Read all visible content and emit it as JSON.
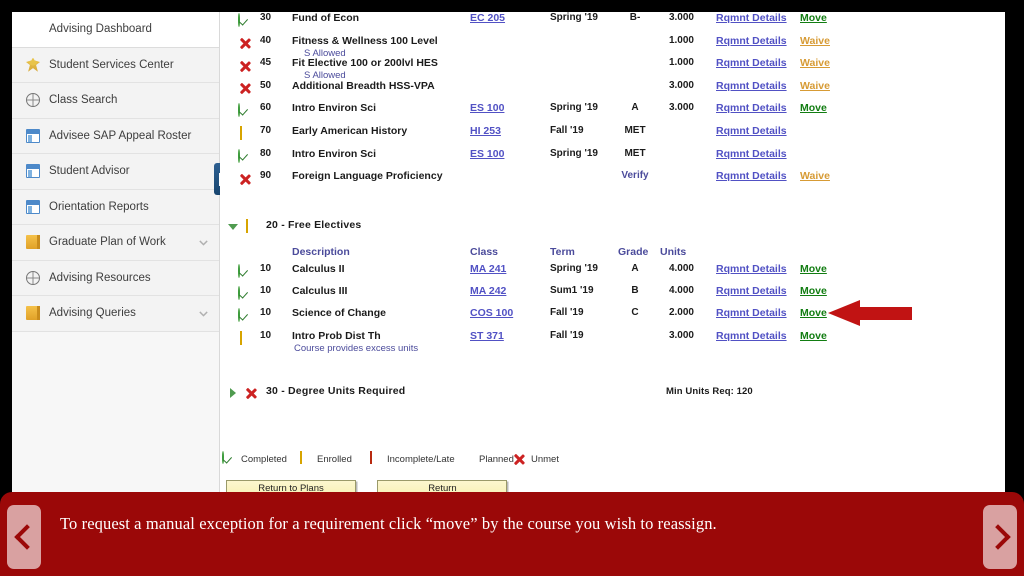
{
  "sidebar": {
    "items": [
      {
        "label": "Advising Dashboard",
        "icon": "none",
        "chevron": false
      },
      {
        "label": "Student Services Center",
        "icon": "person-star-icon",
        "chevron": false
      },
      {
        "label": "Class Search",
        "icon": "globe-icon",
        "chevron": false
      },
      {
        "label": "Advisee SAP Appeal Roster",
        "icon": "window-icon",
        "chevron": false
      },
      {
        "label": "Student Advisor",
        "icon": "window-icon",
        "chevron": false
      },
      {
        "label": "Orientation Reports",
        "icon": "window-icon",
        "chevron": false
      },
      {
        "label": "Graduate Plan of Work",
        "icon": "folder-icon",
        "chevron": true
      },
      {
        "label": "Advising Resources",
        "icon": "globe-icon",
        "chevron": false
      },
      {
        "label": "Advising Queries",
        "icon": "folder-icon",
        "chevron": true
      }
    ]
  },
  "main": {
    "top_rows": [
      {
        "status": "completed",
        "seq": "30",
        "desc": "Fund of Econ",
        "note": "",
        "class": "EC 205",
        "term": "Spring '19",
        "grade": "B-",
        "units": "3.000",
        "details": "Rqmnt Details",
        "action": "Move",
        "action_type": "move"
      },
      {
        "status": "unmet",
        "seq": "40",
        "desc": "Fitness & Wellness 100 Level",
        "note": "S Allowed",
        "class": "",
        "term": "",
        "grade": "",
        "units": "1.000",
        "details": "Rqmnt Details",
        "action": "Waive",
        "action_type": "waive"
      },
      {
        "status": "unmet",
        "seq": "45",
        "desc": "Fit Elective 100 or 200lvl HES",
        "note": "S Allowed",
        "class": "",
        "term": "",
        "grade": "",
        "units": "1.000",
        "details": "Rqmnt Details",
        "action": "Waive",
        "action_type": "waive"
      },
      {
        "status": "unmet",
        "seq": "50",
        "desc": "Additional Breadth HSS-VPA",
        "note": "",
        "class": "",
        "term": "",
        "grade": "",
        "units": "3.000",
        "details": "Rqmnt Details",
        "action": "Waive",
        "action_type": "waive"
      },
      {
        "status": "completed",
        "seq": "60",
        "desc": "Intro Environ Sci",
        "note": "",
        "class": "ES 100",
        "term": "Spring '19",
        "grade": "A",
        "units": "3.000",
        "details": "Rqmnt Details",
        "action": "Move",
        "action_type": "move"
      },
      {
        "status": "enrolled",
        "seq": "70",
        "desc": "Early American History",
        "note": "",
        "class": "HI 253",
        "term": "Fall '19",
        "grade": "MET",
        "units": "",
        "details": "Rqmnt Details",
        "action": "",
        "action_type": "none"
      },
      {
        "status": "completed",
        "seq": "80",
        "desc": "Intro Environ Sci",
        "note": "",
        "class": "ES 100",
        "term": "Spring '19",
        "grade": "MET",
        "units": "",
        "details": "Rqmnt Details",
        "action": "",
        "action_type": "none"
      },
      {
        "status": "unmet",
        "seq": "90",
        "desc": "Foreign Language Proficiency",
        "note": "",
        "class": "",
        "term": "",
        "grade": "Verify",
        "units": "",
        "details": "Rqmnt Details",
        "action": "Waive",
        "action_type": "waive"
      }
    ],
    "free_electives": {
      "header": "20 - Free Electives",
      "header_status": "enrolled",
      "expanded": true,
      "columns": {
        "description": "Description",
        "class": "Class",
        "term": "Term",
        "grade": "Grade",
        "units": "Units"
      },
      "rows": [
        {
          "status": "completed",
          "seq": "10",
          "desc": "Calculus II",
          "note": "",
          "class": "MA 241",
          "term": "Spring '19",
          "grade": "A",
          "units": "4.000",
          "details": "Rqmnt Details",
          "action": "Move",
          "action_type": "move"
        },
        {
          "status": "completed",
          "seq": "10",
          "desc": "Calculus III",
          "note": "",
          "class": "MA 242",
          "term": "Sum1 '19",
          "grade": "B",
          "units": "4.000",
          "details": "Rqmnt Details",
          "action": "Move",
          "action_type": "move"
        },
        {
          "status": "completed",
          "seq": "10",
          "desc": "Science of Change",
          "note": "",
          "class": "COS 100",
          "term": "Fall '19",
          "grade": "C",
          "units": "2.000",
          "details": "Rqmnt Details",
          "action": "Move",
          "action_type": "move"
        },
        {
          "status": "enrolled",
          "seq": "10",
          "desc": "Intro Prob Dist Th",
          "note": "Course provides excess units",
          "class": "ST 371",
          "term": "Fall '19",
          "grade": "",
          "units": "3.000",
          "details": "Rqmnt Details",
          "action": "Move",
          "action_type": "move"
        }
      ]
    },
    "degree_units": {
      "header": "30 - Degree Units Required",
      "header_status": "unmet",
      "expanded": false,
      "min_units": "Min Units Req: 120"
    },
    "legend": [
      {
        "icon": "completed",
        "label": "Completed"
      },
      {
        "icon": "enrolled",
        "label": "Enrolled"
      },
      {
        "icon": "incomplete",
        "label": "Incomplete/Late"
      },
      {
        "icon": "planned",
        "label": "Planned"
      },
      {
        "icon": "unmet",
        "label": "Unmet"
      }
    ],
    "buttons": [
      {
        "label": "Return to Plans"
      },
      {
        "label": "Return"
      }
    ]
  },
  "annotation": {
    "arrow_direction": "left"
  },
  "caption": {
    "text": "To request a manual exception for a requirement click “move” by the course you wish to reassign.",
    "prev_label": "Previous",
    "next_label": "Next"
  },
  "colors": {
    "caption_bg": "#9b0808",
    "arrow": "#c11313",
    "move_link": "#127d12",
    "waive_link": "#d79b35",
    "details_link": "#5151c4"
  }
}
